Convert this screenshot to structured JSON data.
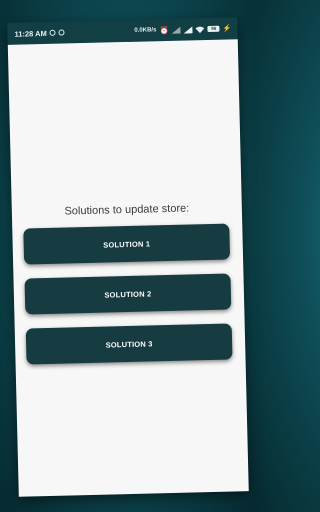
{
  "status_bar": {
    "time": "11:28 AM",
    "network_speed": "0.0KB/s",
    "battery_level": "96"
  },
  "main": {
    "heading": "Solutions to update store:",
    "buttons": [
      {
        "label": "SOLUTION 1"
      },
      {
        "label": "SOLUTION 2"
      },
      {
        "label": "SOLUTION 3"
      }
    ]
  },
  "colors": {
    "status_bar": "#123f44",
    "button": "#163b41",
    "background": "#0f4e58",
    "content": "#f7f7f7"
  }
}
